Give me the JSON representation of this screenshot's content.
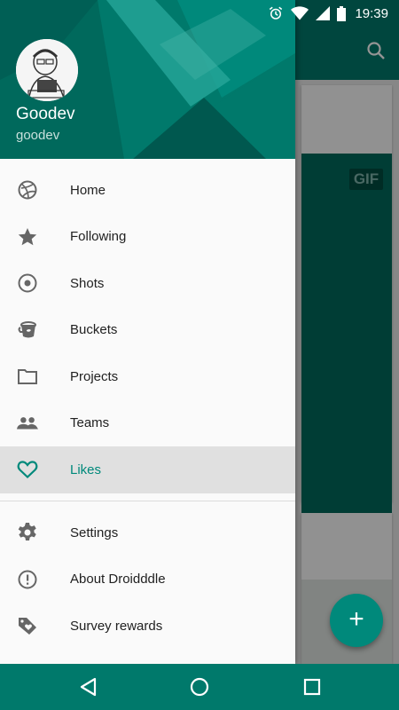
{
  "status": {
    "time": "19:39"
  },
  "card": {
    "gif_label": "GIF"
  },
  "drawer": {
    "user_name": "Goodev",
    "user_handle": "goodev",
    "items": [
      {
        "label": "Home",
        "icon": "basketball-icon"
      },
      {
        "label": "Following",
        "icon": "star-icon"
      },
      {
        "label": "Shots",
        "icon": "target-icon"
      },
      {
        "label": "Buckets",
        "icon": "bucket-icon"
      },
      {
        "label": "Projects",
        "icon": "folder-icon"
      },
      {
        "label": "Teams",
        "icon": "people-icon"
      },
      {
        "label": "Likes",
        "icon": "heart-icon",
        "selected": true
      }
    ],
    "secondary_items": [
      {
        "label": "Settings",
        "icon": "gear-icon"
      },
      {
        "label": "About Droidddle",
        "icon": "info-alert-icon"
      },
      {
        "label": "Survey rewards",
        "icon": "tag-heart-icon"
      }
    ]
  },
  "fab": {
    "label": "+"
  },
  "colors": {
    "primary": "#00796b",
    "accent": "#00897b",
    "header": "#00695c"
  }
}
